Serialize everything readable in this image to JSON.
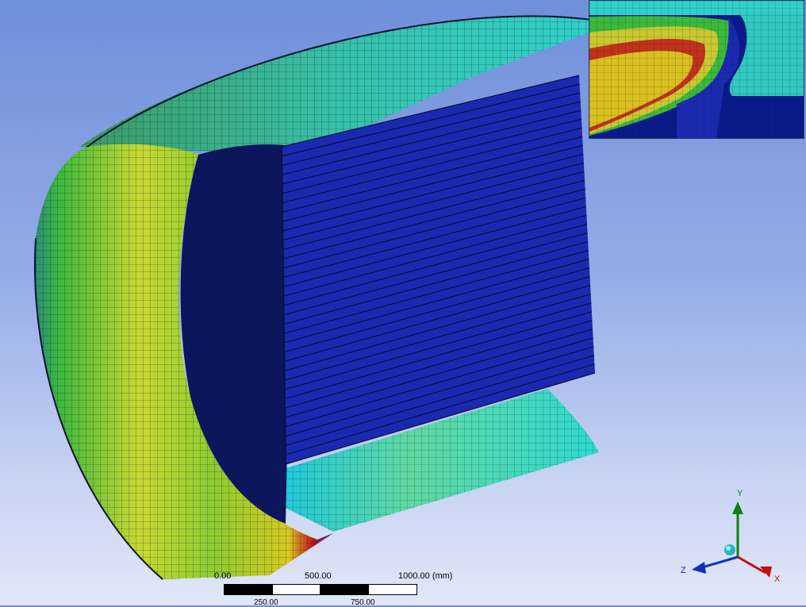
{
  "scale": {
    "labels": [
      "0.00",
      "500.00",
      "1000.00 (mm)"
    ],
    "sub_labels": [
      "250.00",
      "750.00"
    ]
  },
  "triad": {
    "x_label": "X",
    "y_label": "Y",
    "z_label": "Z",
    "x_color": "#d01010",
    "y_color": "#108010",
    "z_color": "#1030c0"
  },
  "colors": {
    "mesh_blue": "#1a2ab0",
    "cyan": "#3ad6d0",
    "green": "#3cb83c",
    "yellow": "#d8d820",
    "red": "#c01818"
  }
}
